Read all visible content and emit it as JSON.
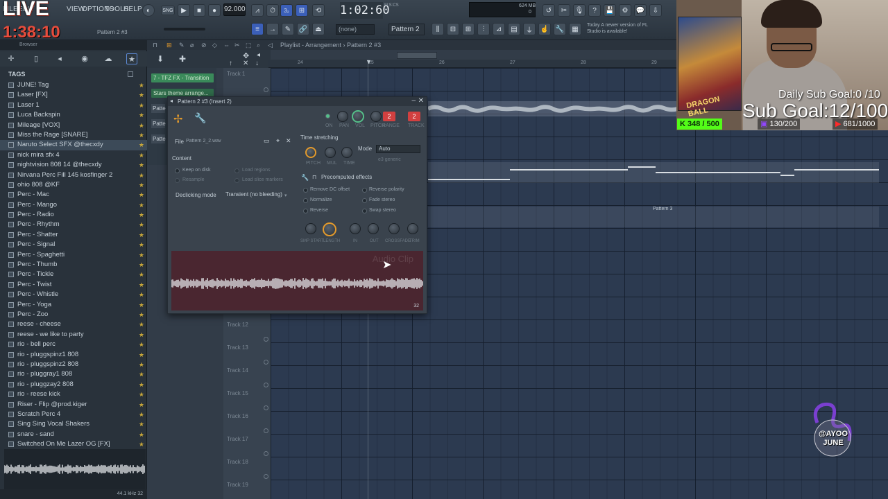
{
  "menu": [
    "FILE",
    "EDIT",
    "VIEW",
    "OPTIONS",
    "TOOLS",
    "HELP"
  ],
  "overlay": {
    "live": "LIVE",
    "timer": "1:38:10",
    "daily_goal": "Daily Sub Goal:0  /10",
    "sub_goal": "Sub Goal:12/100",
    "kick": "348 / 500",
    "twitch": "130/200",
    "youtube": "681/1000",
    "poster_text": "DRAGON BALL",
    "logo_text": "@AYOO JUNE"
  },
  "toolbar": {
    "tempo": "92.000",
    "song_time": "1:02:60",
    "msc": "M:S:CS",
    "pattern": "Pattern 2",
    "none_select": "(none)",
    "memory": "624 MB",
    "voices": "0",
    "new_version": "Today  A newer version of FL Studio is available!",
    "hint": "Pattern 2 #3"
  },
  "browser": {
    "header": "Browser",
    "tags_label": "TAGS",
    "selected_index": 6,
    "items": [
      "JUNE! Tag",
      "Laser [FX]",
      "Laser 1",
      "Luca Backspin",
      "Mileage [VOX]",
      "Miss the Rage [SNARE]",
      "Naruto Select SFX @thecxdy",
      "nick mira sfx 4",
      "nightvision 808 14 @thecxdy",
      "Nirvana Perc Fill 145 kosfinger 2",
      "ohio 808 @KF",
      "Perc - Mac",
      "Perc - Mango",
      "Perc - Radio",
      "Perc - Rhythm",
      "Perc - Shatter",
      "Perc - Signal",
      "Perc - Spaghetti",
      "Perc - Thumb",
      "Perc - Tickle",
      "Perc - Twist",
      "Perc - Whistle",
      "Perc - Yoga",
      "Perc - Zoo",
      "reese - cheese",
      "reese - we like to party",
      "rio - bell perc",
      "rio - pluggspinz1 808",
      "rio - pluggspinz2 808",
      "rio - pluggray1 808",
      "rio - pluggzay2 808",
      "rio - reese kick",
      "Riser - Flip @prod.kiger",
      "Scratch Perc 4",
      "Sing Sing Vocal Shakers",
      "snare - sand",
      "Switched On Me Lazer OG [FX]"
    ],
    "footer": "44.1 kHz 32"
  },
  "playlist": {
    "title": "Playlist - Arrangement › Pattern 2 #3",
    "ruler": [
      "24",
      "25",
      "26",
      "27",
      "28",
      "29"
    ],
    "tracks": [
      "Track 1",
      "Track 12",
      "Track 13",
      "Track 14",
      "Track 15",
      "Track 16",
      "Track 17",
      "Track 18",
      "Track 19"
    ],
    "patterns": [
      "7 - TFZ FX - Transition",
      "Stars theme arrange..."
    ],
    "pattern_side": [
      "Patte",
      "Patte",
      "Patte"
    ],
    "clip_label": "Pattern 3"
  },
  "channel": {
    "title": "Pattern 2 #3 (Insert 2)",
    "knob_labels": [
      "ON",
      "PAN",
      "VOL",
      "PITCH",
      "RANGE",
      "TRACK"
    ],
    "range": "2",
    "track": "2",
    "file_label": "File",
    "file_name": "Pattern 2_2.wav",
    "content": "Content",
    "keep_on_disk": "Keep on disk",
    "resample": "Resample",
    "load_regions": "Load regions",
    "load_slice": "Load slice markers",
    "declicking_label": "Declicking mode",
    "declicking_value": "Transient (no bleeding)",
    "time_stretching": "Time stretching",
    "ts_knobs": [
      "PITCH",
      "MUL",
      "TIME"
    ],
    "mode_label": "Mode",
    "mode_value": "Auto",
    "e3_generic": "e3 generic",
    "precomputed": "Precomputed effects",
    "effects_left": [
      "Remove DC offset",
      "Normalize",
      "Reverse"
    ],
    "effects_right": [
      "Reverse polarity",
      "Fade stereo",
      "Swap stereo"
    ],
    "bottom_knobs": [
      "SMP START",
      "LENGTH",
      "IN",
      "OUT",
      "CROSSFADE",
      "TRIM"
    ],
    "watermark": "Audio Clip",
    "bits": "32"
  },
  "colors": {
    "accent": "#55c08a",
    "orange": "#e39a2c",
    "red": "#d24040",
    "sample_bg": "#4a2630"
  }
}
